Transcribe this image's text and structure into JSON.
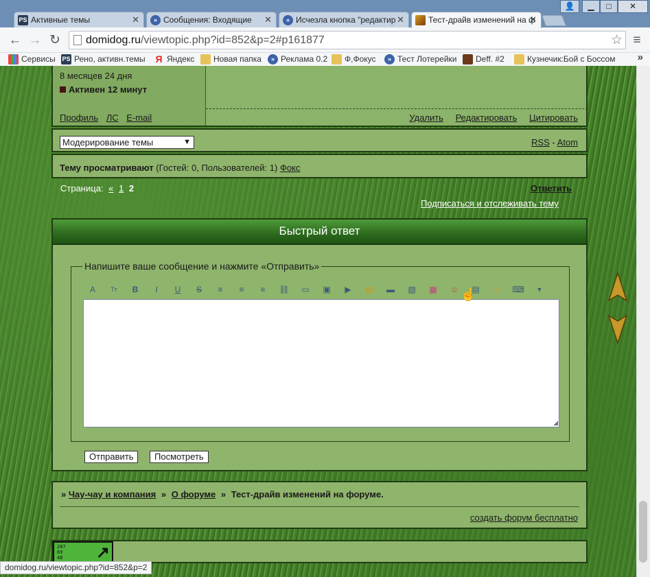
{
  "tabs": [
    {
      "label": "Активные темы",
      "icon": "PS"
    },
    {
      "label": "Сообщения: Входящие",
      "icon": "»"
    },
    {
      "label": "Исчезла кнопка \"редактир",
      "icon": "»"
    },
    {
      "label": "Тест-драйв изменений на ф",
      "icon": "img"
    }
  ],
  "address": {
    "host": "domidog.ru",
    "path": "/viewtopic.php?id=852&p=2#p161877"
  },
  "bookmarks": [
    {
      "label": "Сервисы",
      "icon": "apps"
    },
    {
      "label": "Рено, активн.темы",
      "icon": "PS"
    },
    {
      "label": "Яндекс",
      "icon": "Я"
    },
    {
      "label": "Новая папка",
      "icon": "folder"
    },
    {
      "label": "Реклама 0.2",
      "icon": "»"
    },
    {
      "label": "Ф,Фокус",
      "icon": "folder"
    },
    {
      "label": "Тест Лотерейки",
      "icon": "»"
    },
    {
      "label": "Deff. #2",
      "icon": "img"
    },
    {
      "label": "Кузнечик:Бой с Боссом",
      "icon": "folder"
    }
  ],
  "post": {
    "duration": "8 месяцев 24 дня",
    "status": "Активен 12 минут",
    "profile_links": [
      "Профиль",
      "ЛС",
      "E-mail"
    ],
    "actions": [
      "Удалить",
      "Редактировать",
      "Цитировать"
    ]
  },
  "moderation": {
    "select_value": "Модерирование темы",
    "rss": "RSS",
    "dash": "-",
    "atom": "Atom"
  },
  "viewers": {
    "label": "Тему просматривают",
    "counts": "(Гостей: 0, Пользователей: 1)",
    "user": "Фокс"
  },
  "pager": {
    "label": "Страница:",
    "prev": "«",
    "page1": "1",
    "current": "2"
  },
  "reply_link": "Ответить",
  "subscribe_link": "Подписаться и отслеживать тему",
  "quick_reply": {
    "title": "Быстрый ответ",
    "legend": "Напишите ваше сообщение и нажмите «Отправить»",
    "submit": "Отправить",
    "preview": "Посмотреть"
  },
  "breadcrumbs": {
    "sep": "»",
    "items": [
      "Чау-чау и компания",
      "О форуме"
    ],
    "current": "Тест-драйв изменений на форуме."
  },
  "create_forum": "создать форум бесплатно",
  "counter": {
    "digits": [
      "287",
      "69",
      "48"
    ]
  },
  "status_url": "domidog.ru/viewtopic.php?id=852&p=2",
  "colors": {
    "grass": "#4a8a2e",
    "panel": "#8fb46c",
    "header": "#2d6a1e"
  }
}
